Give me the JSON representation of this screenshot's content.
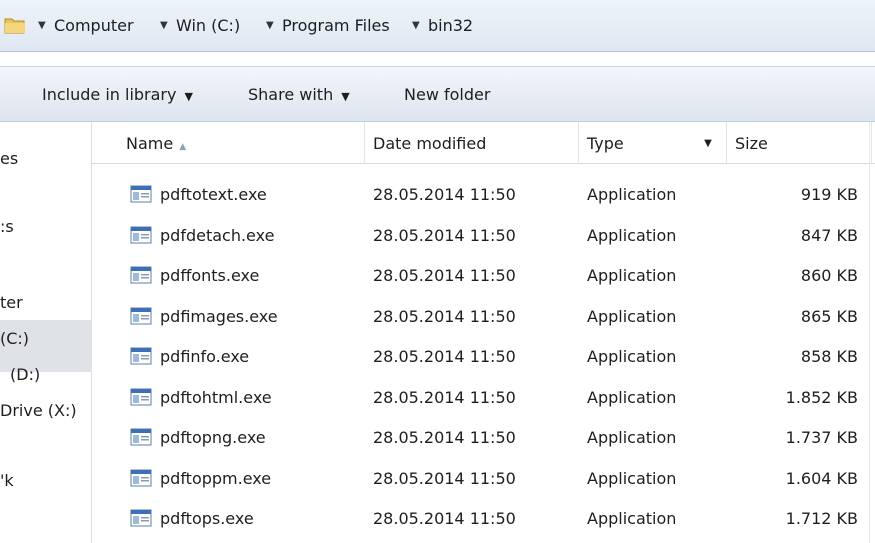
{
  "address": {
    "crumbs": [
      "Computer",
      "Win (C:)",
      "Program Files",
      "bin32"
    ]
  },
  "toolbar": {
    "include_label": "Include in library",
    "share_label": "Share with",
    "new_folder_label": "New folder"
  },
  "nav": {
    "items": [
      "es",
      ":s",
      "ter",
      "(C:)",
      "(D:)",
      "Drive (X:)",
      "'k"
    ]
  },
  "columns": {
    "name": "Name",
    "date": "Date modified",
    "type": "Type",
    "size": "Size"
  },
  "files": [
    {
      "name": "pdftotext.exe",
      "date": "28.05.2014 11:50",
      "type": "Application",
      "size": "919 KB"
    },
    {
      "name": "pdfdetach.exe",
      "date": "28.05.2014 11:50",
      "type": "Application",
      "size": "847 KB"
    },
    {
      "name": "pdffonts.exe",
      "date": "28.05.2014 11:50",
      "type": "Application",
      "size": "860 KB"
    },
    {
      "name": "pdfimages.exe",
      "date": "28.05.2014 11:50",
      "type": "Application",
      "size": "865 KB"
    },
    {
      "name": "pdfinfo.exe",
      "date": "28.05.2014 11:50",
      "type": "Application",
      "size": "858 KB"
    },
    {
      "name": "pdftohtml.exe",
      "date": "28.05.2014 11:50",
      "type": "Application",
      "size": "1.852 KB"
    },
    {
      "name": "pdftopng.exe",
      "date": "28.05.2014 11:50",
      "type": "Application",
      "size": "1.737 KB"
    },
    {
      "name": "pdftoppm.exe",
      "date": "28.05.2014 11:50",
      "type": "Application",
      "size": "1.604 KB"
    },
    {
      "name": "pdftops.exe",
      "date": "28.05.2014 11:50",
      "type": "Application",
      "size": "1.712 KB"
    }
  ]
}
